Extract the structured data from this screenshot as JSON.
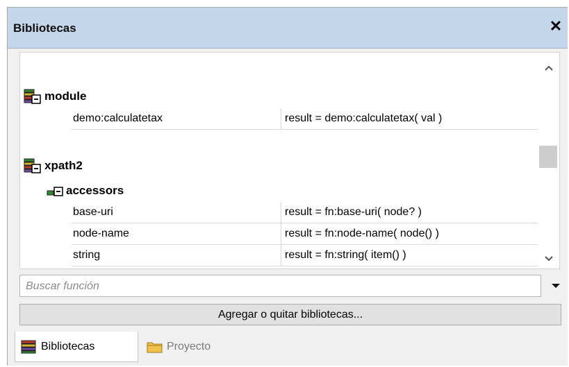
{
  "panel": {
    "title": "Bibliotecas",
    "close_symbol": "✕"
  },
  "groups": [
    {
      "name": "module",
      "icon": "library-group-icon",
      "functions": [
        {
          "name": "demo:calculatetax",
          "signature": "result = demo:calculatetax( val )"
        }
      ]
    },
    {
      "name": "xpath2",
      "icon": "library-group-icon",
      "subgroups": [
        {
          "name": "accessors",
          "icon": "function-group-icon",
          "functions": [
            {
              "name": "base-uri",
              "signature": "result = fn:base-uri( node? )"
            },
            {
              "name": "node-name",
              "signature": "result = fn:node-name( node() )"
            },
            {
              "name": "string",
              "signature": "result = fn:string( item() )"
            }
          ]
        }
      ]
    }
  ],
  "search": {
    "placeholder": "Buscar función",
    "value": ""
  },
  "add_button_label": "Agregar o quitar bibliotecas...",
  "tabs": [
    {
      "label": "Bibliotecas",
      "icon": "books-icon",
      "active": true
    },
    {
      "label": "Proyecto",
      "icon": "folder-icon",
      "active": false
    }
  ],
  "colors": {
    "titlebar": "#c4d6ea",
    "panel_bg": "#f0f0f0"
  }
}
